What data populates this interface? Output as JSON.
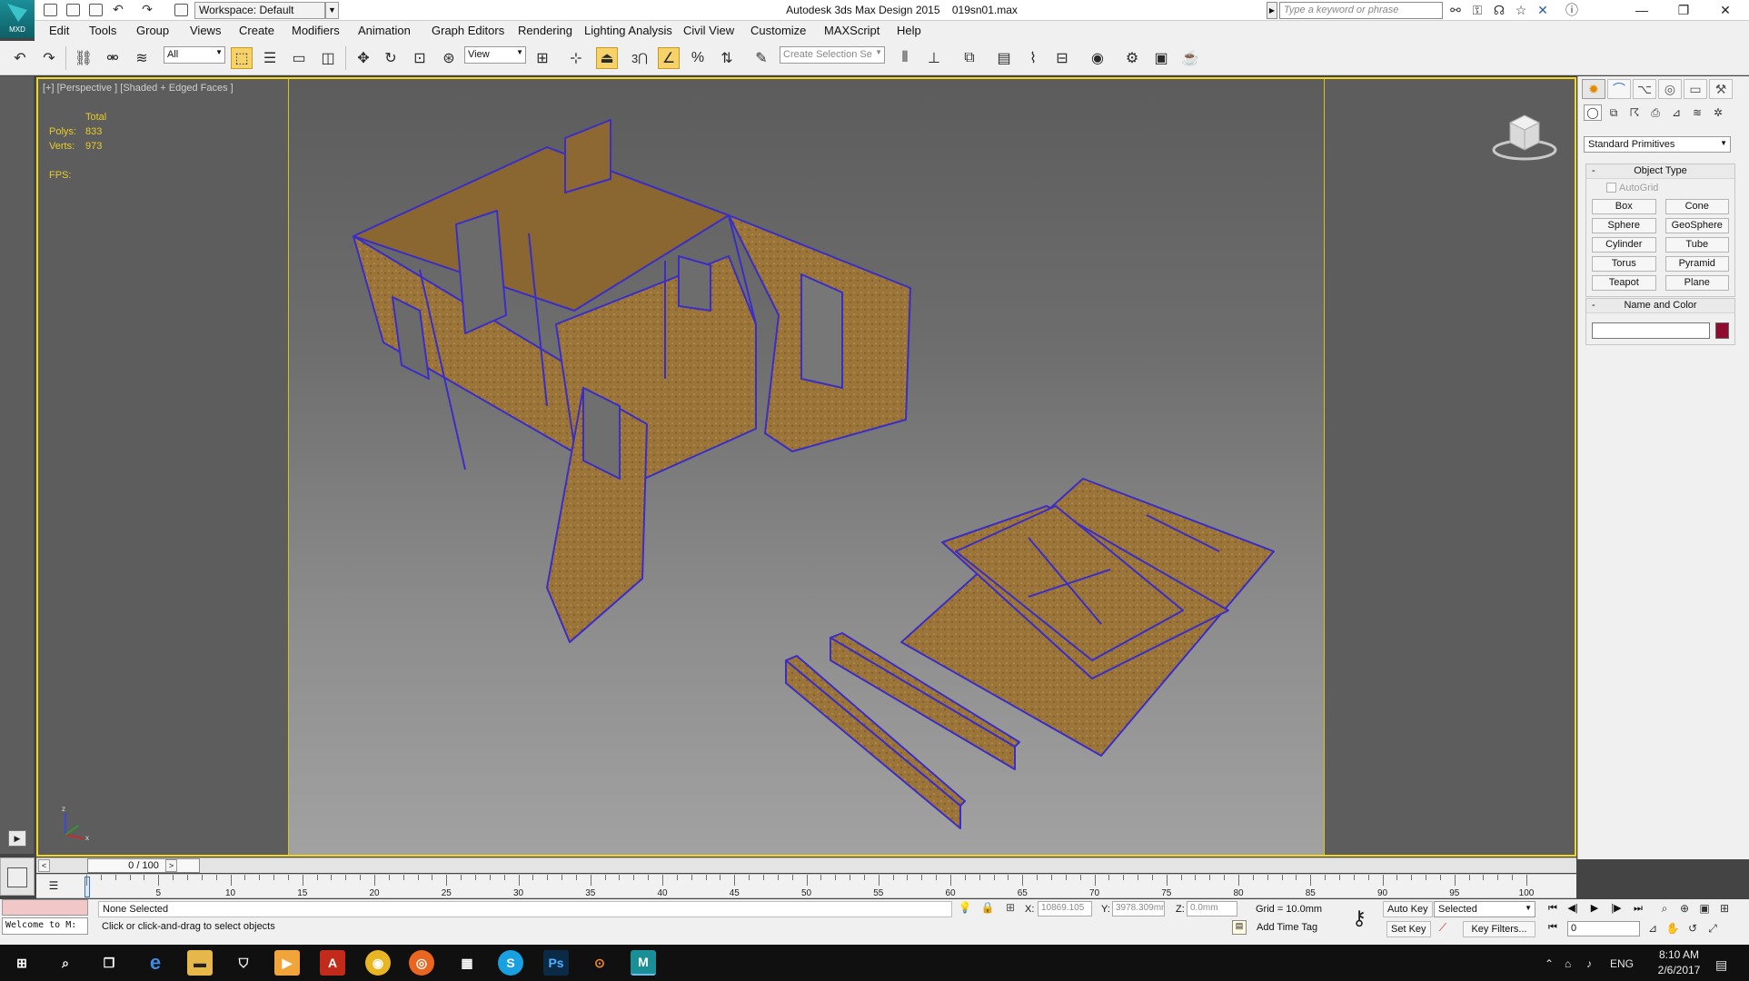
{
  "app": {
    "logo_label": "MXD",
    "window_title": "Autodesk 3ds Max Design 2015",
    "file_name": "019sn01.max",
    "workspace": "Workspace: Default",
    "search_placeholder": "Type a keyword or phrase"
  },
  "menu": [
    "Edit",
    "Tools",
    "Group",
    "Views",
    "Create",
    "Modifiers",
    "Animation",
    "Graph Editors",
    "Rendering",
    "Lighting Analysis",
    "Civil View",
    "Customize",
    "MAXScript",
    "Help"
  ],
  "toolbar": {
    "selection_filter": "All",
    "ref_coord": "View",
    "snap_label": "3",
    "named_selection_placeholder": "Create Selection Se"
  },
  "viewport": {
    "label": "[+] [Perspective ] [Shaded + Edged Faces ]",
    "stats": {
      "header": "Total",
      "polys_label": "Polys:",
      "polys": "833",
      "verts_label": "Verts:",
      "verts": "973",
      "fps_label": "FPS:"
    },
    "axis_z": "z",
    "axis_x": "x"
  },
  "command_panel": {
    "category": "Standard Primitives",
    "object_type_title": "Object Type",
    "autogrid": "AutoGrid",
    "primitives": [
      "Box",
      "Cone",
      "Sphere",
      "GeoSphere",
      "Cylinder",
      "Tube",
      "Torus",
      "Pyramid",
      "Teapot",
      "Plane"
    ],
    "name_color_title": "Name and Color",
    "object_color": "#8e0c2f"
  },
  "timeline": {
    "frame_display": "0 / 100",
    "ticks": [
      "0",
      "5",
      "10",
      "15",
      "20",
      "25",
      "30",
      "35",
      "40",
      "45",
      "50",
      "55",
      "60",
      "65",
      "70",
      "75",
      "80",
      "85",
      "90",
      "95",
      "100"
    ]
  },
  "status": {
    "maxscript_text": "Welcome to M:",
    "selection": "None Selected",
    "prompt": "Click or click-and-drag to select objects",
    "x_label": "X:",
    "x_value": "10869.105",
    "y_label": "Y:",
    "y_value": "3978.309mm",
    "z_label": "Z:",
    "z_value": "0.0mm",
    "grid": "Grid = 10.0mm",
    "add_time_tag": "Add Time Tag",
    "auto_key": "Auto Key",
    "set_key": "Set Key",
    "selected_dd": "Selected",
    "key_filters": "Key Filters...",
    "current_frame": "0"
  },
  "taskbar": {
    "lang": "ENG",
    "time": "8:10 AM",
    "date": "2/6/2017"
  },
  "colors": {
    "viewport_border": "#f3d71d",
    "wood": "#9a7438",
    "edges": "#3a2dc8"
  }
}
